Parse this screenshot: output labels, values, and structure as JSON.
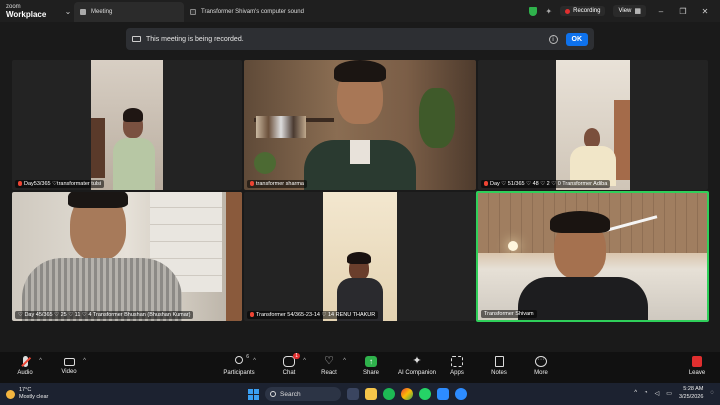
{
  "titlebar": {
    "brand_line1": "zoom",
    "brand_line2": "Workplace",
    "tab_meeting": "Meeting",
    "tab_share": "Transformer Shivam's computer sound",
    "recording": "Recording",
    "view": "View"
  },
  "banner": {
    "text": "This meeting is being recorded.",
    "ok": "OK"
  },
  "tiles": [
    {
      "label": "Day53/365 ♡transformater tulsi"
    },
    {
      "label": "transformer sharma"
    },
    {
      "label": "Day ♡ 51/365 ♡ 48 ♡ 2 ♡ 0 Transformer Adiba"
    },
    {
      "label": "♡ Day 45/365 ♡ 25 ♡ 11 ♡ 4 Transformer Bhushan (Bhushan Kumar)"
    },
    {
      "label": "Transformer 54/365-23-14 ♡ 14 RENU THAKUR"
    },
    {
      "label": "Transformer Shivam"
    }
  ],
  "toolbar": {
    "audio": "Audio",
    "video": "Video",
    "participants": "Participants",
    "participants_count": "6",
    "chat": "Chat",
    "chat_badge": "1",
    "react": "React",
    "share": "Share",
    "ai_companion": "AI Companion",
    "apps": "Apps",
    "notes": "Notes",
    "more": "More",
    "leave": "Leave"
  },
  "taskbar": {
    "temp": "17°C",
    "condition": "Mostly clear",
    "search": "Search",
    "time": "5:28 AM",
    "date": "3/25/2026"
  },
  "colors": {
    "accent": "#0e72ed",
    "active_speaker": "#2fcf5a",
    "recording_red": "#e02f2f",
    "share_green": "#2fb24c"
  }
}
